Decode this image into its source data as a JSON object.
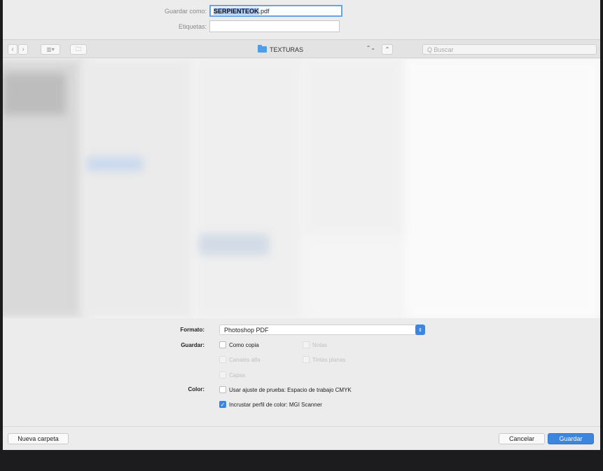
{
  "save_as": {
    "label": "Guardar como:",
    "filename_selected": "SERPIENTEOK",
    "filename_ext": ".pdf"
  },
  "tags": {
    "label": "Etiquetas:",
    "value": ""
  },
  "toolbar": {
    "back": "‹",
    "forward": "›",
    "view_mode": "▥▾",
    "new_folder": "🗀",
    "location": "TEXTURAS",
    "location_arrows": "⌃⌄",
    "collapse": "⌃",
    "search_placeholder": "Q Buscar"
  },
  "options": {
    "format_label": "Formato:",
    "format_value": "Photoshop PDF",
    "save_label": "Guardar:",
    "color_label": "Color:",
    "checkboxes": {
      "como_copia": "Como copia",
      "notas": "Notas",
      "canales_alfa": "Canales alfa",
      "tintas_planas": "Tintas planas",
      "capas": "Capas",
      "usar_ajuste": "Usar ajuste de prueba: Espacio de trabajo CMYK",
      "incrustar_perfil": "Incrustar perfil de color: MGI Scanner"
    }
  },
  "footer": {
    "new_folder": "Nueva carpeta",
    "cancel": "Cancelar",
    "save": "Guardar"
  },
  "colors": {
    "accent": "#3d86de",
    "selection": "#a9c8f2"
  }
}
